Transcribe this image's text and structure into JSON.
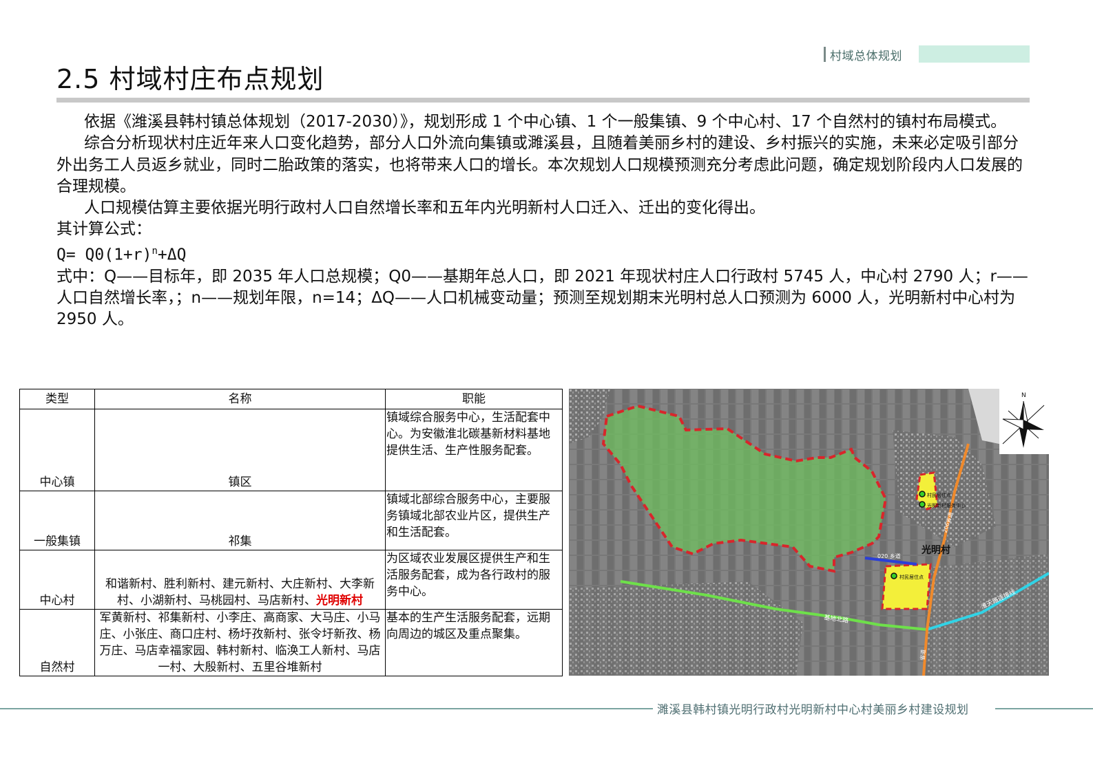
{
  "header": {
    "section_tag": "村域总体规划",
    "title": "2.5  村域村庄布点规划"
  },
  "body": {
    "p1": "依据《潍溪县韩村镇总体规划（2017-2030）》，规划形成 1 个中心镇、1 个一般集镇、9 个中心村、17 个自然村的镇村布局模式。",
    "p2": "综合分析现状村庄近年来人口变化趋势，部分人口外流向集镇或濉溪县，且随着美丽乡村的建设、乡村振兴的实施，未来必定吸引部分外出务工人员返乡就业，同时二胎政策的落实，也将带来人口的增长。本次规划人口规模预测充分考虑此问题，确定规划阶段内人口发展的合理规模。",
    "p3": "人口规模估算主要依据光明行政村人口自然增长率和五年内光明新村人口迁入、迁出的变化得出。",
    "formula_label": "其计算公式：",
    "formula_main": "Q= Q0(1+r)",
    "formula_exp": "n",
    "formula_tail": "+ΔQ",
    "explain": "式中：Q——目标年，即 2035 年人口总规模；Q0——基期年总人口，即 2021 年现状村庄人口行政村 5745 人，中心村 2790 人；r——人口自然增长率，；n——规划年限，n=14；ΔQ——人口机械变动量；预测至规划期末光明村总人口预测为 6000 人，光明新村中心村为 2950 人。"
  },
  "table": {
    "headers": [
      "类型",
      "名称",
      "职能"
    ],
    "rows": [
      {
        "type": "中心镇",
        "name": "镇区",
        "function": "镇域综合服务中心，生活配套中心。为安徽淮北碳基新材料基地提供生活、生产性服务配套。"
      },
      {
        "type": "一般集镇",
        "name": "祁集",
        "function": "镇域北部综合服务中心，主要服务镇域北部农业片区，提供生产和生活配套。"
      },
      {
        "type": "中心村",
        "name": "和谐新村、胜利新村、建元新村、大庄新村、大李新村、小湖新村、马桃园村、马店新村、",
        "name_highlight": "光明新村",
        "function": "为区域农业发展区提供生产和生活服务配套，成为各行政村的服务中心。"
      },
      {
        "type": "自然村",
        "name": "军黄新村、祁集新村、小李庄、高商家、大马庄、小马庄、小张庄、商口庄村、杨圩孜新村、张令圩新孜、杨万庄、马店幸福家园、韩村新村、临涣工人新村、马店一村、大殷新村、五里谷堆新村",
        "function": "基本的生产生活服务配套，远期向周边的城区及重点聚集。"
      }
    ]
  },
  "map": {
    "compass_label": "N",
    "village_label": "光明村",
    "marker1_label": "村民居住点",
    "marker2_label": "光明新村服务中心",
    "marker3_label": "村民居住点",
    "road_020": "020 乡道",
    "road_jidi": "基地北路",
    "road_huai": "淮天路连接线",
    "road_206": "206省道",
    "road_s": "省道",
    "colors": {
      "village_area": "#6fbf5f",
      "boundary": "#d8262b",
      "settlement": "#f3ef3a",
      "green_road": "#6ee04a",
      "cyan_road": "#31d3e6",
      "orange_road": "#f08a2c",
      "blue_road": "#2b3fd6"
    }
  },
  "footer": {
    "text": "濉溪县韩村镇光明行政村光明新村中心村美丽乡村建设规划"
  }
}
